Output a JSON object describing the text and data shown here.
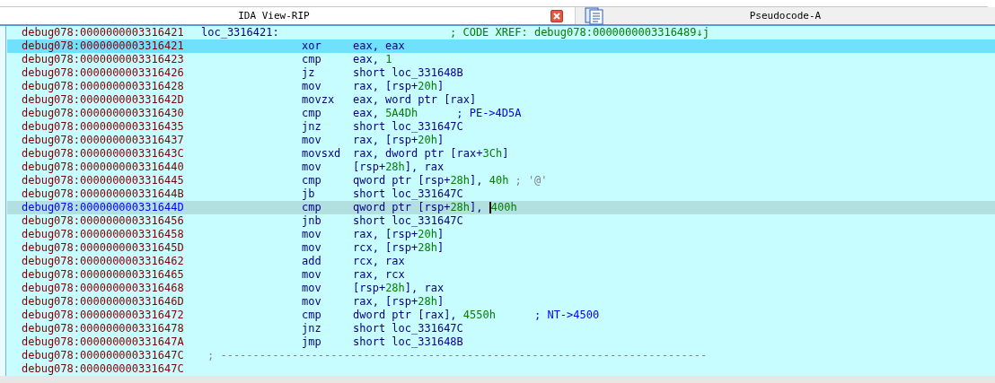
{
  "tabs": [
    {
      "label": "IDA View-RIP",
      "selected": true,
      "closable": true
    },
    {
      "label": "Pseudocode-A",
      "selected": false,
      "closable": false
    }
  ],
  "lines": [
    {
      "kind": "label",
      "address": "debug078:0000000003316421",
      "label": "loc_3316421:",
      "comment": [
        {
          "kind": "xref",
          "text": "; CODE XREF: debug078:0000000003316489↓j"
        }
      ],
      "selected": false,
      "current": false
    },
    {
      "kind": "insn",
      "address": "debug078:0000000003316421",
      "mnemonic": "xor",
      "operands": [
        {
          "kind": "plain",
          "text": "eax, eax"
        }
      ],
      "selected": true,
      "current": false
    },
    {
      "kind": "insn",
      "address": "debug078:0000000003316423",
      "mnemonic": "cmp",
      "operands": [
        {
          "kind": "plain",
          "text": "eax, "
        },
        {
          "kind": "num",
          "text": "1"
        }
      ],
      "selected": false,
      "current": false
    },
    {
      "kind": "insn",
      "address": "debug078:0000000003316426",
      "mnemonic": "jz",
      "operands": [
        {
          "kind": "plain",
          "text": "short loc_331648B"
        }
      ],
      "selected": false,
      "current": false
    },
    {
      "kind": "insn",
      "address": "debug078:0000000003316428",
      "mnemonic": "mov",
      "operands": [
        {
          "kind": "plain",
          "text": "rax, [rsp+"
        },
        {
          "kind": "num",
          "text": "20h"
        },
        {
          "kind": "plain",
          "text": "]"
        }
      ],
      "selected": false,
      "current": false
    },
    {
      "kind": "insn",
      "address": "debug078:000000000331642D",
      "mnemonic": "movzx",
      "operands": [
        {
          "kind": "plain",
          "text": "eax, word ptr [rax]"
        }
      ],
      "selected": false,
      "current": false
    },
    {
      "kind": "insn",
      "address": "debug078:0000000003316430",
      "mnemonic": "cmp",
      "operands": [
        {
          "kind": "plain",
          "text": "eax, "
        },
        {
          "kind": "num",
          "text": "5A4Dh"
        }
      ],
      "comment": [
        {
          "kind": "note",
          "text": "; PE->4D5A"
        }
      ],
      "selected": false,
      "current": false
    },
    {
      "kind": "insn",
      "address": "debug078:0000000003316435",
      "mnemonic": "jnz",
      "operands": [
        {
          "kind": "plain",
          "text": "short loc_331647C"
        }
      ],
      "selected": false,
      "current": false
    },
    {
      "kind": "insn",
      "address": "debug078:0000000003316437",
      "mnemonic": "mov",
      "operands": [
        {
          "kind": "plain",
          "text": "rax, [rsp+"
        },
        {
          "kind": "num",
          "text": "20h"
        },
        {
          "kind": "plain",
          "text": "]"
        }
      ],
      "selected": false,
      "current": false
    },
    {
      "kind": "insn",
      "address": "debug078:000000000331643C",
      "mnemonic": "movsxd",
      "operands": [
        {
          "kind": "plain",
          "text": "rax, dword ptr [rax+"
        },
        {
          "kind": "num",
          "text": "3Ch"
        },
        {
          "kind": "plain",
          "text": "]"
        }
      ],
      "selected": false,
      "current": false
    },
    {
      "kind": "insn",
      "address": "debug078:0000000003316440",
      "mnemonic": "mov",
      "operands": [
        {
          "kind": "plain",
          "text": "[rsp+"
        },
        {
          "kind": "num",
          "text": "28h"
        },
        {
          "kind": "plain",
          "text": "], rax"
        }
      ],
      "selected": false,
      "current": false
    },
    {
      "kind": "insn",
      "address": "debug078:0000000003316445",
      "mnemonic": "cmp",
      "operands": [
        {
          "kind": "plain",
          "text": "qword ptr [rsp+"
        },
        {
          "kind": "num",
          "text": "28h"
        },
        {
          "kind": "plain",
          "text": "], "
        },
        {
          "kind": "num",
          "text": "40h"
        }
      ],
      "comment": [
        {
          "kind": "auto",
          "text": "; '@'"
        }
      ],
      "selected": false,
      "current": false
    },
    {
      "kind": "insn",
      "address": "debug078:000000000331644B",
      "mnemonic": "jb",
      "operands": [
        {
          "kind": "plain",
          "text": "short loc_331647C"
        }
      ],
      "selected": false,
      "current": false
    },
    {
      "kind": "insn",
      "address": "debug078:000000000331644D",
      "mnemonic": "cmp",
      "operands": [
        {
          "kind": "plain",
          "text": "qword ptr [rsp+"
        },
        {
          "kind": "num",
          "text": "28h"
        },
        {
          "kind": "plain",
          "text": "], "
        },
        {
          "kind": "num",
          "text": "400h"
        }
      ],
      "selected": false,
      "current": true
    },
    {
      "kind": "insn",
      "address": "debug078:0000000003316456",
      "mnemonic": "jnb",
      "operands": [
        {
          "kind": "plain",
          "text": "short loc_331647C"
        }
      ],
      "selected": false,
      "current": false
    },
    {
      "kind": "insn",
      "address": "debug078:0000000003316458",
      "mnemonic": "mov",
      "operands": [
        {
          "kind": "plain",
          "text": "rax, [rsp+"
        },
        {
          "kind": "num",
          "text": "20h"
        },
        {
          "kind": "plain",
          "text": "]"
        }
      ],
      "selected": false,
      "current": false
    },
    {
      "kind": "insn",
      "address": "debug078:000000000331645D",
      "mnemonic": "mov",
      "operands": [
        {
          "kind": "plain",
          "text": "rcx, [rsp+"
        },
        {
          "kind": "num",
          "text": "28h"
        },
        {
          "kind": "plain",
          "text": "]"
        }
      ],
      "selected": false,
      "current": false
    },
    {
      "kind": "insn",
      "address": "debug078:0000000003316462",
      "mnemonic": "add",
      "operands": [
        {
          "kind": "plain",
          "text": "rcx, rax"
        }
      ],
      "selected": false,
      "current": false
    },
    {
      "kind": "insn",
      "address": "debug078:0000000003316465",
      "mnemonic": "mov",
      "operands": [
        {
          "kind": "plain",
          "text": "rax, rcx"
        }
      ],
      "selected": false,
      "current": false
    },
    {
      "kind": "insn",
      "address": "debug078:0000000003316468",
      "mnemonic": "mov",
      "operands": [
        {
          "kind": "plain",
          "text": "[rsp+"
        },
        {
          "kind": "num",
          "text": "28h"
        },
        {
          "kind": "plain",
          "text": "], rax"
        }
      ],
      "selected": false,
      "current": false
    },
    {
      "kind": "insn",
      "address": "debug078:000000000331646D",
      "mnemonic": "mov",
      "operands": [
        {
          "kind": "plain",
          "text": "rax, [rsp+"
        },
        {
          "kind": "num",
          "text": "28h"
        },
        {
          "kind": "plain",
          "text": "]"
        }
      ],
      "selected": false,
      "current": false
    },
    {
      "kind": "insn",
      "address": "debug078:0000000003316472",
      "mnemonic": "cmp",
      "operands": [
        {
          "kind": "plain",
          "text": "dword ptr [rax], "
        },
        {
          "kind": "num",
          "text": "4550h"
        }
      ],
      "comment": [
        {
          "kind": "note",
          "text": "; NT->4500"
        }
      ],
      "selected": false,
      "current": false
    },
    {
      "kind": "insn",
      "address": "debug078:0000000003316478",
      "mnemonic": "jnz",
      "operands": [
        {
          "kind": "plain",
          "text": "short loc_331647C"
        }
      ],
      "selected": false,
      "current": false
    },
    {
      "kind": "insn",
      "address": "debug078:000000000331647A",
      "mnemonic": "jmp",
      "operands": [
        {
          "kind": "plain",
          "text": "short loc_331648B"
        }
      ],
      "selected": false,
      "current": false
    },
    {
      "kind": "separator",
      "address": "debug078:000000000331647C",
      "separator": "; ---------------------------------------------------------------------------",
      "selected": false,
      "current": false
    },
    {
      "kind": "blank",
      "address": "debug078:000000000331647C",
      "selected": false,
      "current": false
    }
  ]
}
